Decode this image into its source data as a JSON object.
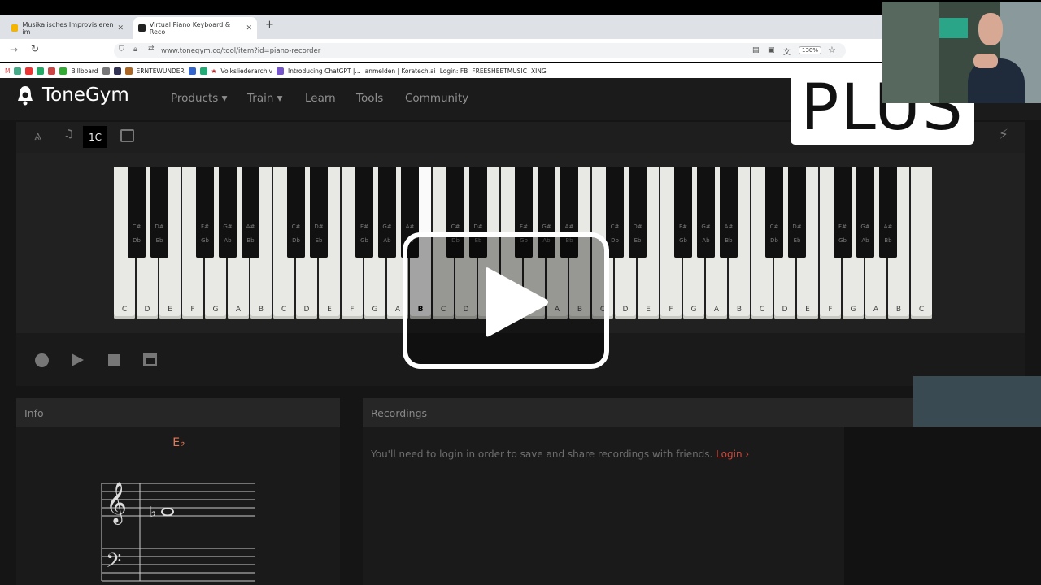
{
  "browser": {
    "tabs": [
      {
        "title": "Musikalisches Improvisieren im",
        "active": false
      },
      {
        "title": "Virtual Piano Keyboard & Reco",
        "active": true
      }
    ],
    "new_tab": "+",
    "url": "www.tonegym.co/tool/item?id=piano-recorder",
    "zoom": "130%",
    "bookmarks": [
      "Billboard",
      "ERNTEWUNDER",
      "Volksliederarchiv",
      "Introducing ChatGPT |...",
      "anmelden | Koratech.ai",
      "Login: FB",
      "FREESHEETMUSIC",
      "XING"
    ]
  },
  "site": {
    "brand": "ToneGym",
    "nav": [
      {
        "label": "Products ▾"
      },
      {
        "label": "Train ▾"
      },
      {
        "label": "Learn"
      },
      {
        "label": "Tools"
      },
      {
        "label": "Community"
      }
    ]
  },
  "toolbar": {
    "octave_value": "1C",
    "icons": [
      "metronome-icon",
      "bell-icon",
      "keyboard-icon",
      "plug-icon"
    ]
  },
  "keyboard": {
    "white_keys": [
      "C",
      "D",
      "E",
      "F",
      "G",
      "A",
      "B",
      "C",
      "D",
      "E",
      "F",
      "G",
      "A",
      "B",
      "C",
      "D",
      "E",
      "F",
      "G",
      "A",
      "B",
      "C",
      "D",
      "E",
      "F",
      "G",
      "A",
      "B",
      "C",
      "D",
      "E",
      "F",
      "G",
      "A",
      "B",
      "C"
    ],
    "highlighted_white_index": 13,
    "black_key_labels": {
      "after_C": [
        "C#",
        "Db"
      ],
      "after_D": [
        "D#",
        "Eb"
      ],
      "after_F": [
        "F#",
        "Gb"
      ],
      "after_G": [
        "G#",
        "Ab"
      ],
      "after_A": [
        "A#",
        "Bb"
      ]
    }
  },
  "controls": [
    "record-icon",
    "play-icon",
    "stop-icon",
    "archive-icon"
  ],
  "info": {
    "title": "Info",
    "note_name": "E♭"
  },
  "recordings": {
    "title": "Recordings",
    "message": "You'll need to login in order to save and share recordings with friends.",
    "login_link": "Login ›"
  },
  "overlay": {
    "plus_badge": "PLUS"
  },
  "colors": {
    "accent": "#d2483c",
    "note": "#e07a5a",
    "background": "#151515"
  }
}
